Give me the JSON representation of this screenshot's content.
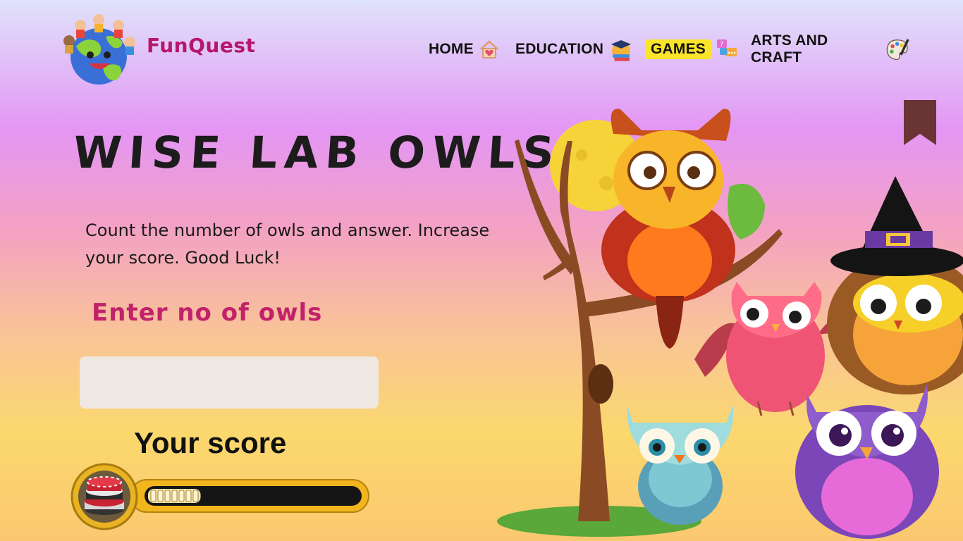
{
  "brand": {
    "name": "FunQuest",
    "primary_color": "#b5176a"
  },
  "nav": {
    "items": [
      {
        "label": "HOME",
        "icon": "home-heart-icon",
        "active": false
      },
      {
        "label": "EDUCATION",
        "icon": "graduation-books-icon",
        "active": false
      },
      {
        "label": "GAMES",
        "icon": "chat-bubbles-icon",
        "active": true
      },
      {
        "label": "ARTS AND CRAFT",
        "icon": "paint-palette-icon",
        "active": false
      }
    ],
    "active_highlight": "#fbe42a"
  },
  "page": {
    "title": "WISE LAB OWLS",
    "description": "Count the number of owls and answer. Increase your score. Good Luck!",
    "input_label": "Enter no of owls",
    "answer_value": "",
    "score_label": "Your score",
    "score_progress": 0.25,
    "accent_color": "#c1226a"
  },
  "icons": {
    "bookmark": "bookmark-icon",
    "chips": "poker-chips-icon"
  }
}
